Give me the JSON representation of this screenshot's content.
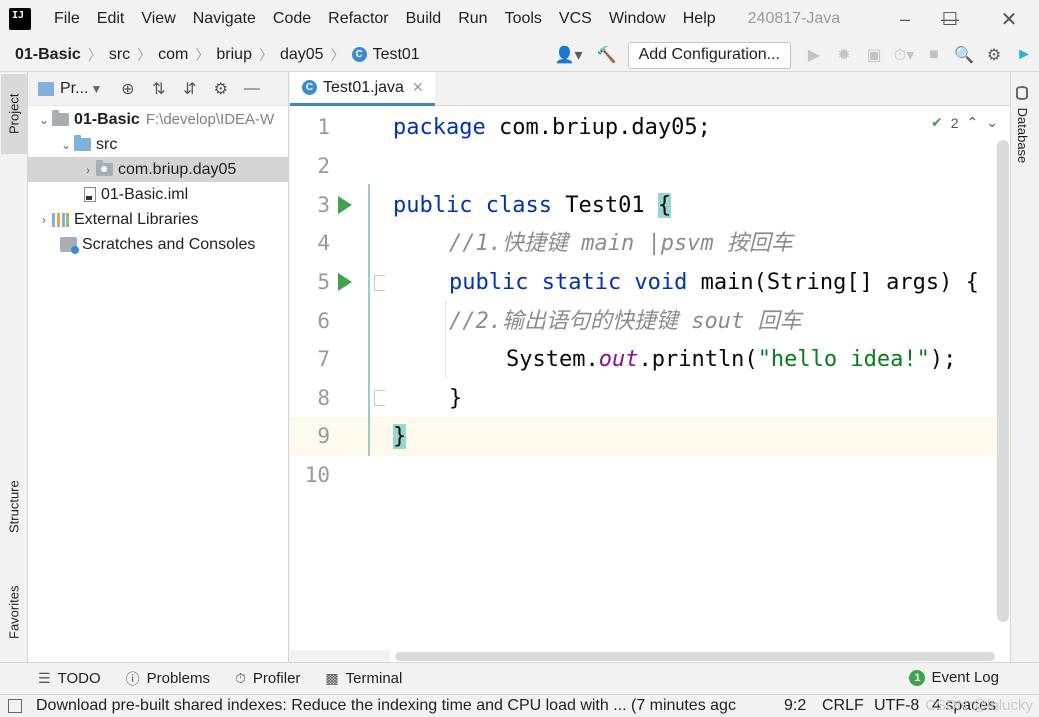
{
  "menubar": {
    "items": [
      "File",
      "Edit",
      "View",
      "Navigate",
      "Code",
      "Refactor",
      "Build",
      "Run",
      "Tools",
      "VCS",
      "Window",
      "Help"
    ],
    "window_title": "240817-Java"
  },
  "navbar": {
    "crumbs": [
      "01-Basic",
      "src",
      "com",
      "briup",
      "day05",
      "Test01"
    ],
    "add_configuration": "Add Configuration..."
  },
  "left_strip": {
    "project_tab": "Project",
    "structure_tab": "Structure",
    "favorites_tab": "Favorites"
  },
  "project_panel": {
    "title": "Pr...",
    "tree": {
      "root_name": "01-Basic",
      "root_path": "F:\\develop\\IDEA-W",
      "src": "src",
      "package": "com.briup.day05",
      "iml": "01-Basic.iml",
      "external_libraries": "External Libraries",
      "scratches": "Scratches and Consoles"
    }
  },
  "editor": {
    "tab_label": "Test01.java",
    "inspection_count": "2",
    "line_numbers": [
      "1",
      "2",
      "3",
      "4",
      "5",
      "6",
      "7",
      "8",
      "9",
      "10"
    ],
    "code": {
      "l1_kw": "package",
      "l1_rest": " com.briup.day05;",
      "l3_kw": "public class",
      "l3_name": " Test01 ",
      "l3_brace": "{",
      "l4_comment": "//1.快捷键 main |psvm 按回车",
      "l5_kw": "public static void",
      "l5_rest": " main(String[] args) {",
      "l6_comment": "//2.输出语句的快捷键 sout 回车",
      "l7_pre": "System.",
      "l7_field": "out",
      "l7_mid": ".println(",
      "l7_str": "\"hello idea!\"",
      "l7_end": ");",
      "l8": "}",
      "l9": "}"
    }
  },
  "right_strip": {
    "database_tab": "Database"
  },
  "bottom_tools": {
    "todo": "TODO",
    "problems": "Problems",
    "profiler": "Profiler",
    "terminal": "Terminal",
    "event_log": "Event Log",
    "event_count": "1"
  },
  "statusbar": {
    "message": "Download pre-built shared indexes: Reduce the indexing time and CPU load with ... (7 minutes agc",
    "position": "9:2",
    "line_ending": "CRLF",
    "encoding": "UTF-8",
    "indent": "4 spaces",
    "watermark": "CSDN @lnlucky"
  }
}
